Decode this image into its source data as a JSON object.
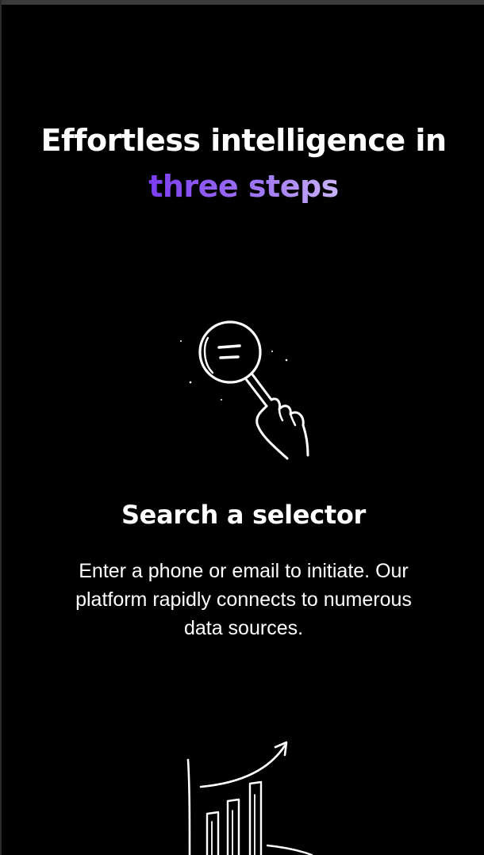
{
  "section": {
    "heading_line1": "Effortless intelligence in",
    "heading_accent": "three steps"
  },
  "steps": [
    {
      "icon": "magnifier-hand-icon",
      "title": "Search a selector",
      "description": "Enter a phone or email to initiate. Our platform rapidly connects to numerous data sources."
    },
    {
      "icon": "growth-chart-icon"
    }
  ],
  "colors": {
    "background": "#000000",
    "text": "#ffffff",
    "accent_start": "#7b3cf0",
    "accent_end": "#c9b4f7"
  }
}
